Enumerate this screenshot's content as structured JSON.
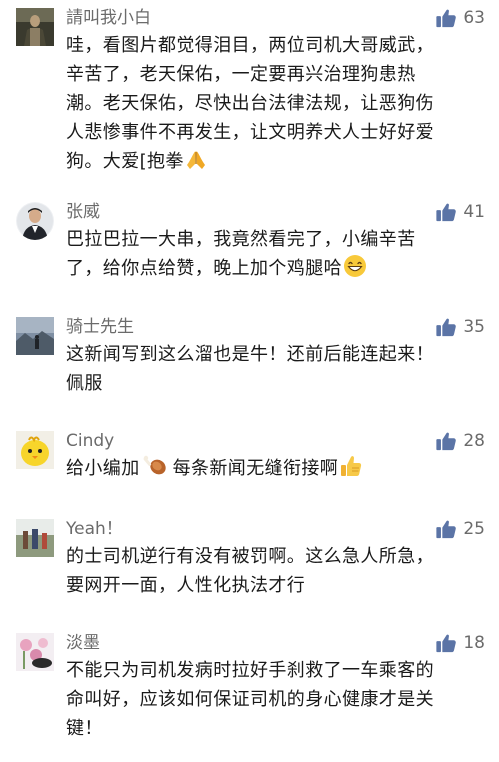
{
  "colors": {
    "username": "#6b6b6b",
    "text": "#1a1a1a",
    "like_icon": "#5b74a6",
    "background": "#ffffff"
  },
  "comments": [
    {
      "author": "請叫我小白",
      "likes": "63",
      "avatar_icon": "dark-portrait-avatar",
      "lines": [
        "哇，看图片都觉得泪目，两位司机大哥威武，",
        "辛苦了，老天保佑，一定要再兴治理狗患热",
        "潮。老天保佑，尽快出台法律法规，让恶狗伤",
        "人悲惨事件不再发生，让文明养犬人士好好爱",
        "狗。大爱[抱拳"
      ],
      "trailing_emoji": "folded-hands-emoji"
    },
    {
      "author": "张威",
      "likes": "41",
      "avatar_icon": "man-in-suit-avatar",
      "lines": [
        "巴拉巴拉一大串，我竟然看完了，小编辛苦",
        "了，给你点给赞，晚上加个鸡腿哈"
      ],
      "trailing_emoji": "grinning-face-emoji"
    },
    {
      "author": "骑士先生",
      "likes": "35",
      "avatar_icon": "landscape-avatar",
      "lines": [
        "这新闻写到这么溜也是牛！还前后能连起来！",
        "佩服"
      ]
    },
    {
      "author": "Cindy",
      "likes": "28",
      "avatar_icon": "yellow-chick-avatar",
      "lines": [
        "给小编加",
        "每条新闻无缝衔接啊"
      ],
      "inline_emoji": "chicken-leg-emoji",
      "trailing_emoji": "thumbs-up-emoji"
    },
    {
      "author": "Yeah！",
      "likes": "25",
      "avatar_icon": "outdoor-photo-avatar",
      "lines": [
        "的士司机逆行有没有被罚啊。这么急人所急，",
        "要网开一面，人性化执法才行"
      ]
    },
    {
      "author": "淡墨",
      "likes": "18",
      "avatar_icon": "flower-avatar",
      "lines": [
        "不能只为司机发病时拉好手刹救了一车乘客的",
        "命叫好，应该如何保证司机的身心健康才是关",
        "键！"
      ]
    }
  ]
}
